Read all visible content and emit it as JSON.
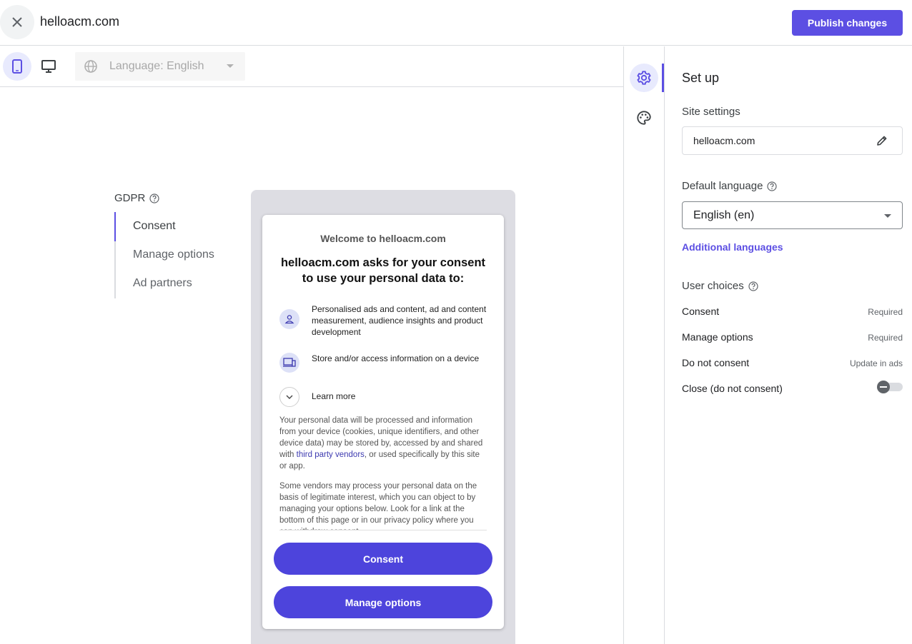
{
  "topbar": {
    "site_title": "helloacm.com",
    "publish_label": "Publish changes"
  },
  "toolbar": {
    "language_label": "Language: English"
  },
  "left_nav": {
    "title": "GDPR",
    "items": [
      {
        "label": "Consent",
        "active": true
      },
      {
        "label": "Manage options",
        "active": false
      },
      {
        "label": "Ad partners",
        "active": false
      }
    ]
  },
  "dialog": {
    "welcome": "Welcome to helloacm.com",
    "heading": "helloacm.com asks for your consent to use your personal data to:",
    "purposes": [
      {
        "icon": "person-icon",
        "text": "Personalised ads and content, ad and content measurement, audience insights and product development"
      },
      {
        "icon": "devices-icon",
        "text": "Store and/or access information on a device"
      }
    ],
    "learn_more": "Learn more",
    "para1_before": "Your personal data will be processed and information from your device (cookies, unique identifiers, and other device data) may be stored by, accessed by and shared with ",
    "para1_link": "third party vendors",
    "para1_after": ", or used specifically by this site or app.",
    "para2": "Some vendors may process your personal data on the basis of legitimate interest, which you can object to by managing your options below. Look for a link at the bottom of this page or in our privacy policy where you can withdraw consent.",
    "consent_button": "Consent",
    "manage_button": "Manage options"
  },
  "panel": {
    "title": "Set up",
    "site_settings_label": "Site settings",
    "site_value": "helloacm.com",
    "default_language_label": "Default language",
    "default_language_value": "English (en)",
    "additional_languages": "Additional languages",
    "user_choices_label": "User choices",
    "choices": [
      {
        "label": "Consent",
        "value": "Required"
      },
      {
        "label": "Manage options",
        "value": "Required"
      },
      {
        "label": "Do not consent",
        "value": "Update in ads"
      },
      {
        "label": "Close (do not consent)",
        "value": ""
      }
    ]
  },
  "colors": {
    "accent": "#5c4fe3",
    "dialog_button": "#4d44dc"
  }
}
